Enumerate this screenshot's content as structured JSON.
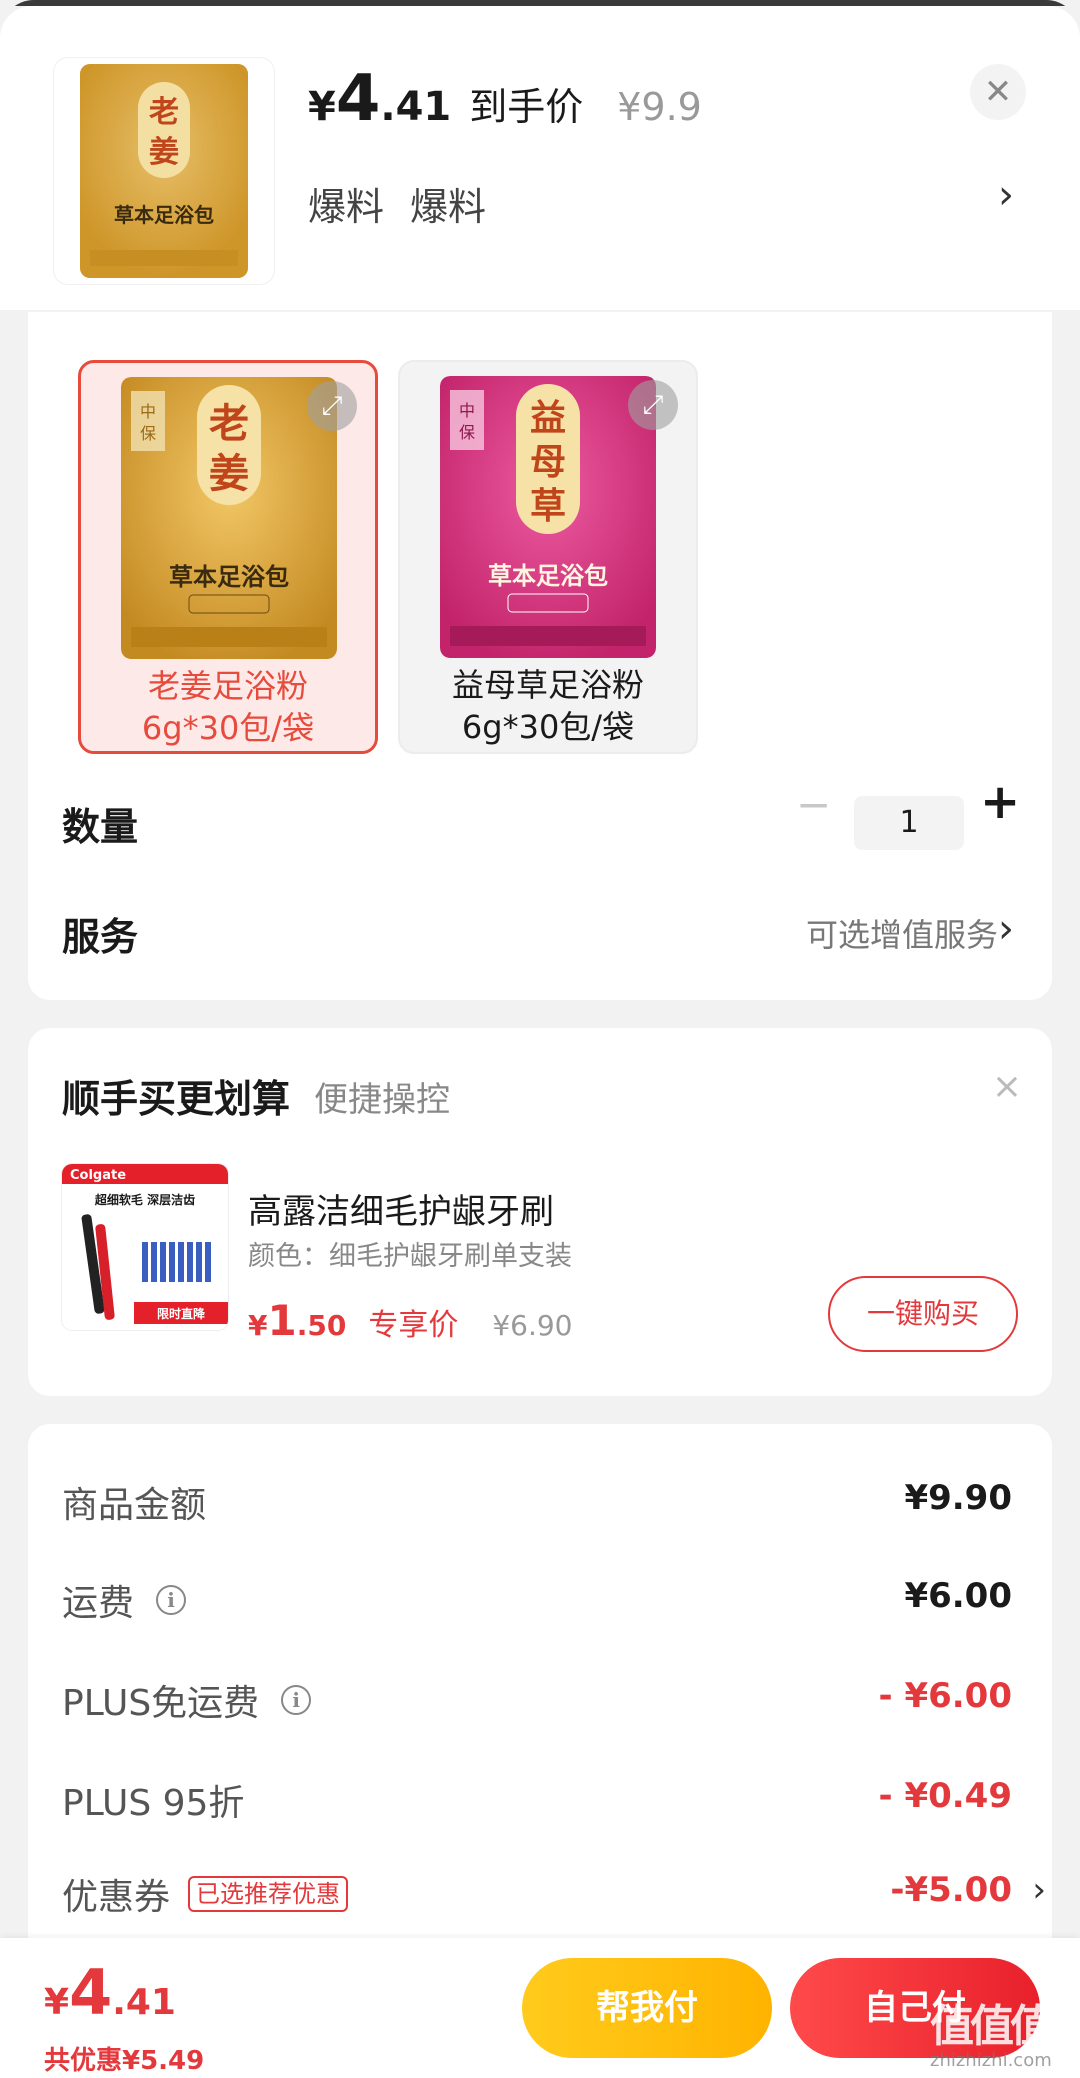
{
  "header": {
    "price_yen": "¥",
    "price_int": "4",
    "price_dec": ".41",
    "daoshou_label": "到手价",
    "original_price": "¥9.9",
    "tags": [
      "爆料",
      "爆料"
    ],
    "close_icon": "close-icon",
    "chevron": "›",
    "thumb_text_main": "老姜",
    "thumb_text_sub": "草本足浴包"
  },
  "variants": [
    {
      "img_main": "老姜",
      "img_sub": "草本足浴包",
      "brand": "中保堂",
      "line1": "老姜足浴粉",
      "line2": "6g*30包/袋",
      "selected": true,
      "color": "#d9a233"
    },
    {
      "img_main": "益母草",
      "img_sub": "草本足浴包",
      "brand": "中保堂",
      "line1": "益母草足浴粉",
      "line2": "6g*30包/袋",
      "selected": false,
      "color": "#d9347a"
    }
  ],
  "quantity": {
    "label": "数量",
    "value": "1",
    "minus": "−",
    "plus": "+"
  },
  "service": {
    "label": "服务",
    "value": "可选增值服务",
    "chevron": "›"
  },
  "addon": {
    "title": "顺手买更划算",
    "subtitle": "便捷操控",
    "close": "×",
    "product_name": "高露洁细毛护龈牙刷",
    "spec": "颜色：细毛护龈牙刷单支装",
    "price_yen": "¥",
    "price_int": "1",
    "price_dec": ".50",
    "exclusive_label": "专享价",
    "original_price": "¥6.90",
    "buy_button": "一键购买",
    "img_brand": "Colgate",
    "img_text1": "超细软毛 深层洁齿",
    "img_badge": "限时直降"
  },
  "fees": [
    {
      "label": "商品金额",
      "value": "¥9.90",
      "red": false,
      "info": false
    },
    {
      "label": "运费",
      "value": "¥6.00",
      "red": false,
      "info": true
    },
    {
      "label": "PLUS免运费",
      "value": "- ¥6.00",
      "red": true,
      "info": true
    },
    {
      "label": "PLUS 95折",
      "value": "- ¥0.49",
      "red": true,
      "info": false
    },
    {
      "label": "优惠券",
      "value": "-¥5.00",
      "red": true,
      "info": false,
      "tag": "已选推荐优惠",
      "chevron": "›"
    }
  ],
  "bottom": {
    "price_yen": "¥",
    "price_int": "4",
    "price_dec": ".41",
    "saved": "共优惠¥5.49",
    "help_pay": "帮我付",
    "self_pay": "自己付"
  },
  "watermark": {
    "main": "值值值",
    "sub": "zhizhizhi.com"
  },
  "colors": {
    "accent_red": "#e4393c",
    "help_yellow": "#ffc21a",
    "ginger_gold": "#d9a233",
    "motherwort_pink": "#d9347a"
  }
}
